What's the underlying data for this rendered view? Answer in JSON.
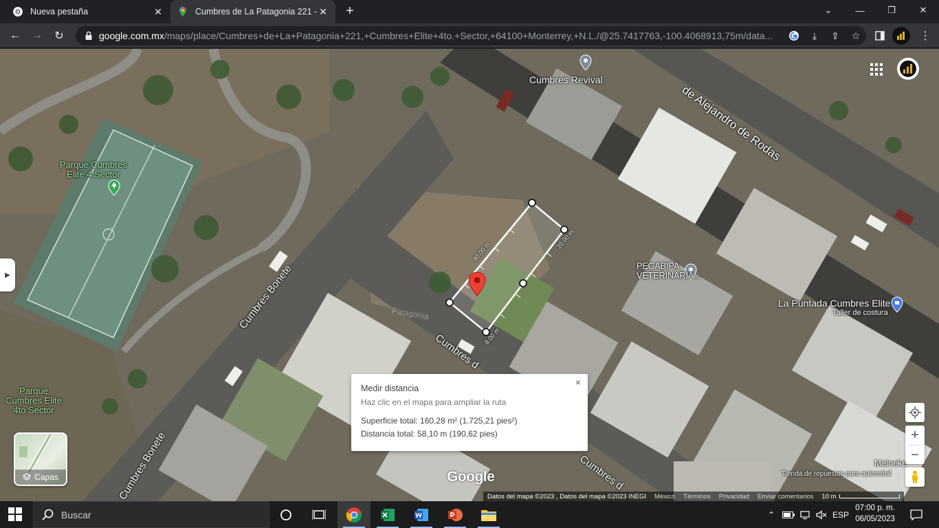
{
  "browser": {
    "tabs": [
      {
        "title": "Nueva pestaña",
        "active": false
      },
      {
        "title": "Cumbres de La Patagonia 221 - G",
        "active": true
      }
    ],
    "new_tab": "+",
    "url_host": "google.com.mx",
    "url_rest": "/maps/place/Cumbres+de+La+Patagonia+221,+Cumbres+Elite+4to.+Sector,+64100+Monterrey,+N.L./@25.7417763,-100.4068913,75m/data..."
  },
  "map": {
    "labels": {
      "cumbres_revival": "Cumbres Revival",
      "alejandro_rodas": "de Alejandro de Rodas",
      "parque_1_line1": "Parque Cumbres",
      "parque_1_line2": "Elite 4 Sector",
      "parque_2_line1": "Parque",
      "parque_2_line2": "Cumbres Elite",
      "parque_2_line3": "4to Sector",
      "cumbres_bonete_1": "Cumbres Bonete",
      "cumbres_bonete_2": "Cumbres Bonete",
      "cumbres_d_1": "Cumbres d",
      "cumbres_d_2": "Cumbres d",
      "pegabipa_1": "PEGABIPA",
      "pegabipa_2": "VETERINARIA...",
      "la_puntada": "La Puntada Cumbres Elite",
      "taller": "Taller de costura",
      "meineke": "Meineke",
      "tienda": "Tienda de repuestos para automóvil",
      "patagonia_faded": "Patagonia"
    },
    "measure_labels": {
      "top_left": "40.00 m",
      "top_right": "20.00 m",
      "bottom": "8.00 m"
    },
    "layers_label": "Capas",
    "google_logo": "Google",
    "attribution": {
      "data": "Datos del mapa ©2023 , Datos del mapa ©2023 INEGI",
      "country": "México",
      "terms": "Términos",
      "privacy": "Privacidad",
      "feedback": "Enviar comentarios",
      "scale": "10 m"
    }
  },
  "popup": {
    "title": "Medir distancia",
    "hint": "Haz clic en el mapa para ampliar la ruta",
    "area": "Superficie total: 160,28 m² (1.725,21 pies²)",
    "distance": "Distancia total: 58,10 m (190,62 pies)",
    "close": "×"
  },
  "taskbar": {
    "search_placeholder": "Buscar",
    "lang": "ESP",
    "time": "07:00 p. m.",
    "date": "06/05/2023"
  }
}
